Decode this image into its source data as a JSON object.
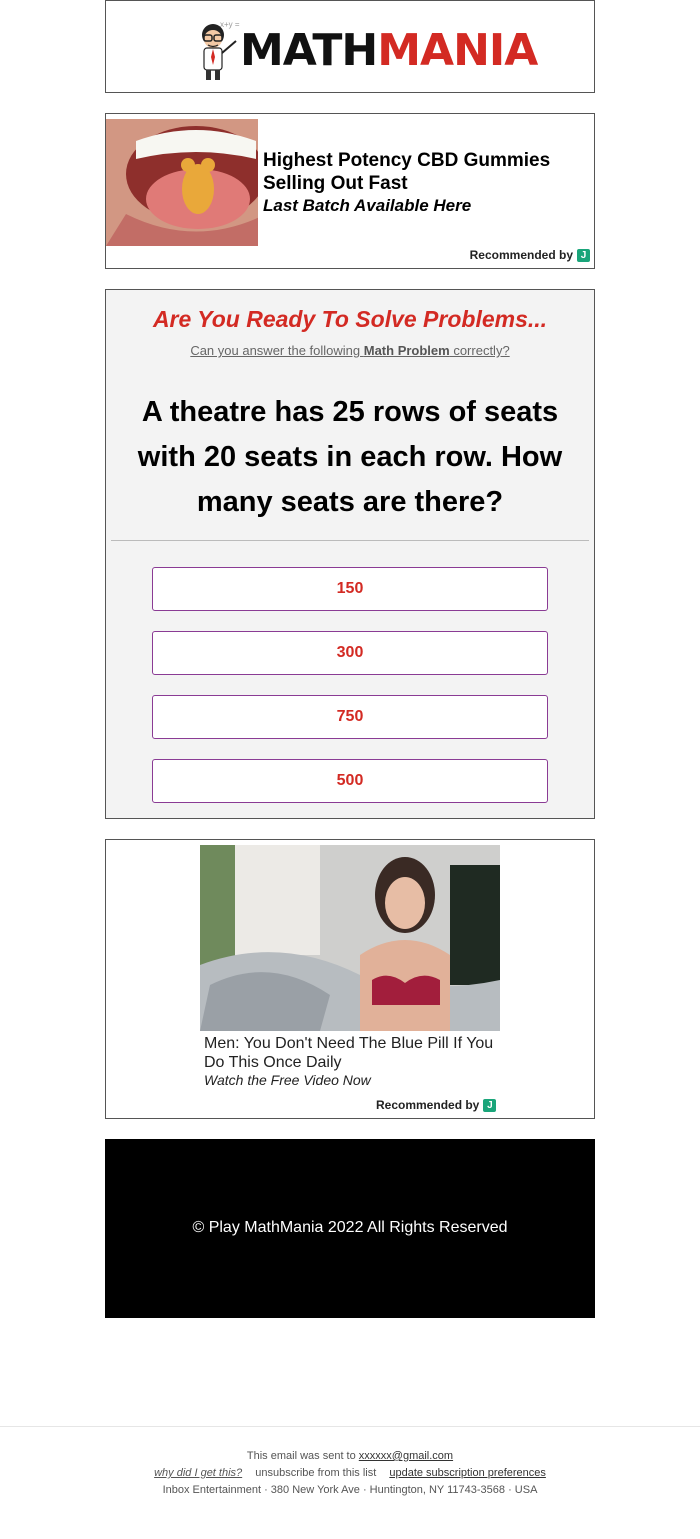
{
  "header": {
    "logo": {
      "math": "MATH",
      "mania": "MANIA",
      "formula": "x+y ="
    }
  },
  "ad1": {
    "title": "Highest Potency CBD Gummies Selling Out Fast",
    "subtitle": "Last Batch Available Here",
    "recommended": "Recommended by",
    "badge": "J"
  },
  "quiz": {
    "headline": "Are You Ready To Solve Problems...",
    "sub_prefix": "Can you answer the following ",
    "sub_bold": "Math Problem",
    "sub_suffix": " correctly?",
    "question": "A theatre has 25 rows of seats with 20 seats in each row. How many seats are there?",
    "answers": [
      "150",
      "300",
      "750",
      "500"
    ]
  },
  "ad2": {
    "title": "Men: You Don't Need The Blue Pill If You Do This Once Daily",
    "subtitle": "Watch the Free Video Now",
    "recommended": "Recommended by",
    "badge": "J"
  },
  "copyright": "© Play MathMania 2022 All Rights Reserved",
  "footer": {
    "sent_to_prefix": "This email was sent to ",
    "email": "xxxxxx@gmail.com",
    "why": "why did I get this?",
    "unsubscribe": "unsubscribe from this list",
    "update": "update subscription preferences",
    "address": "Inbox Entertainment · 380 New York Ave · Huntington, NY 11743-3568 · USA"
  },
  "colors": {
    "accent_red": "#d32a23",
    "button_border": "#8a3b94",
    "badge_green": "#1aa57a"
  }
}
